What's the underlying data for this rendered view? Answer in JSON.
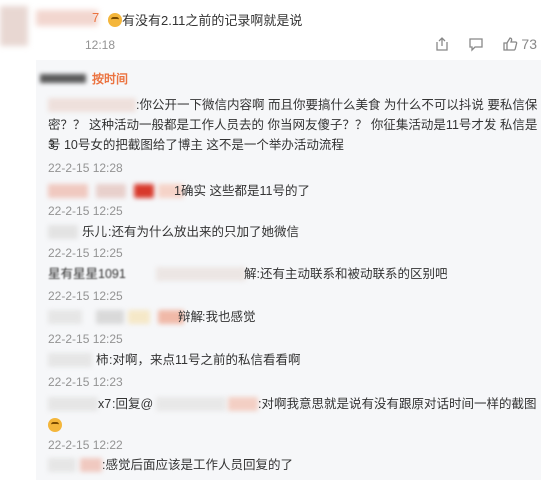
{
  "top_comment": {
    "name_fragment": "7",
    "text": "有没有2.11之前的记录啊就是说",
    "time": "12:18",
    "like_count": "73",
    "icons": [
      "share-icon",
      "comment-icon",
      "like-icon"
    ]
  },
  "thread": {
    "sort_label": "按时间",
    "replies": [
      {
        "name": "",
        "lines": [
          ":你公开一下微信内容啊  而且你要搞什么美食 为什么不可以抖说 要私信保",
          "密？？ 这种活动一般都是工作人员去的  你当网友傻子？？  你征集活动是11号才发  私信是3",
          "号 10号女的把截图给了博主 这不是一个举办活动流程"
        ],
        "time": "22-2-15 12:28"
      },
      {
        "name": "1",
        "lines": [
          " 确实 这些都是11号的了"
        ],
        "time": "22-2-15 12:25"
      },
      {
        "name": "乐儿",
        "lines": [
          ":还有为什么放出来的只加了她微信"
        ],
        "time": "22-2-15 12:25"
      },
      {
        "name": "星有星星1091",
        "lines": [
          "解:还有主动联系和被动联系的区别吧"
        ],
        "time": "22-2-15 12:25"
      },
      {
        "name": "辩解",
        "lines": [
          ":我也感觉"
        ],
        "time": "22-2-15 12:25"
      },
      {
        "name": "柿",
        "lines": [
          ":对啊，来点11号之前的私信看看啊"
        ],
        "time": "22-2-15 12:23"
      },
      {
        "name": "x7",
        "lines": [
          ":回复@",
          ":对啊我意思就是说有没有跟原对话时间一样的截图"
        ],
        "time": "22-2-15 12:22"
      },
      {
        "name": "",
        "lines": [
          ":感觉后面应该是工作人员回复的了"
        ],
        "time": ""
      }
    ]
  },
  "colors": {
    "accent": "#eb7340",
    "muted": "#939393",
    "thread_bg": "#f6f7f9"
  }
}
